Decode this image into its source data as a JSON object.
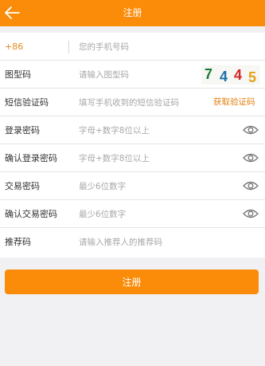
{
  "header": {
    "title": "注册"
  },
  "form": {
    "phone": {
      "prefix": "+86",
      "placeholder": "您的手机号码"
    },
    "captcha": {
      "label": "图型码",
      "placeholder": "请输入图型码",
      "chars": [
        {
          "char": "7",
          "color": "#1e7a3a"
        },
        {
          "char": "4",
          "color": "#1e6fa8"
        },
        {
          "char": "4",
          "color": "#cf2a2a"
        },
        {
          "char": "5",
          "color": "#e5a11a"
        }
      ]
    },
    "sms": {
      "label": "短信验证码",
      "placeholder": "填写手机收到的短信验证码",
      "button": "获取验证码"
    },
    "login_password": {
      "label": "登录密码",
      "placeholder": "字母+数字8位以上"
    },
    "confirm_login_password": {
      "label": "确认登录密码",
      "placeholder": "字母+数字8位以上"
    },
    "trade_password": {
      "label": "交易密码",
      "placeholder": "最少6位数字"
    },
    "confirm_trade_password": {
      "label": "确认交易密码",
      "placeholder": "最少6位数字"
    },
    "referrer": {
      "label": "推荐码",
      "placeholder": "请输入推荐人的推荐码"
    }
  },
  "submit_label": "注册",
  "colors": {
    "accent": "#fa8c0a",
    "background": "#f1f1f3"
  },
  "icons": {
    "back": "arrow-left-icon",
    "toggle": "eye-icon"
  }
}
